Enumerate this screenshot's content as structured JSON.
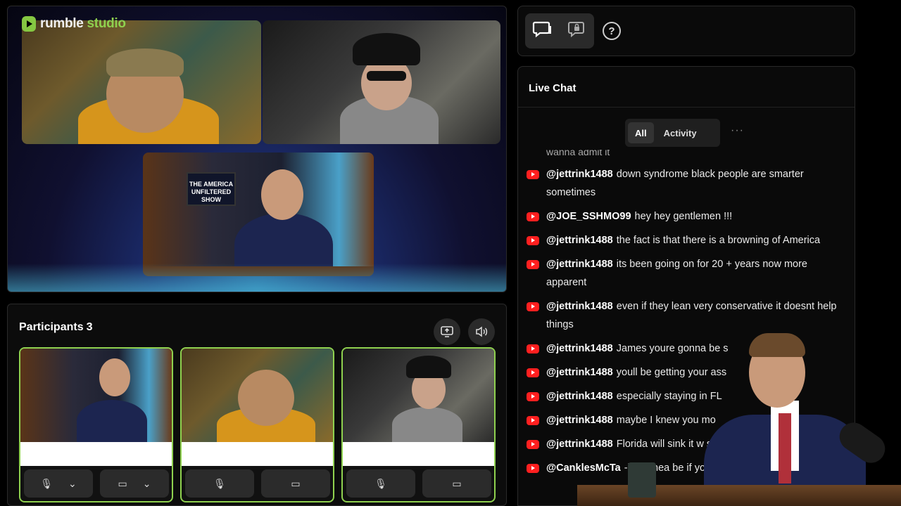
{
  "brand": {
    "logo_prefix": "rumble",
    "logo_suffix": "studio"
  },
  "stage": {
    "tv_text": "THE AMERICA UNFILTERED SHOW"
  },
  "participants": {
    "title": "Participants",
    "count": "3",
    "share_icon": "screen-share-icon",
    "audio_icon": "speaker-icon"
  },
  "toolbar": {
    "chat_icon": "chat-bubbles-icon",
    "private_icon": "locked-chat-icon",
    "help_label": "?"
  },
  "chat": {
    "title": "Live Chat",
    "tabs": [
      {
        "label": "All"
      },
      {
        "label": "Activity"
      }
    ],
    "more": "···",
    "cut_text": "wanna admit it",
    "messages": [
      {
        "user": "@jettrink1488",
        "text": "down syndrome black people are smarter sometimes"
      },
      {
        "user": "@JOE_SSHMO99",
        "text": "hey hey gentlemen !!!"
      },
      {
        "user": "@jettrink1488",
        "text": "the fact is that there is a browning of America"
      },
      {
        "user": "@jettrink1488",
        "text": "its been going on for 20 + years now more apparent"
      },
      {
        "user": "@jettrink1488",
        "text": "even if they lean very conservative it doesnt help things"
      },
      {
        "user": "@jettrink1488",
        "text": "James youre gonna be s"
      },
      {
        "user": "@jettrink1488",
        "text": "youll be getting your ass"
      },
      {
        "user": "@jettrink1488",
        "text": "especially staying in FL"
      },
      {
        "user": "@jettrink1488",
        "text": "maybe I knew you mo"
      },
      {
        "user": "@jettrink1488",
        "text": "Florida will sink it w sunk"
      },
      {
        "user": "@CanklesMcTa",
        "text": "-b5s I hea be if youre crazy"
      }
    ]
  },
  "colors": {
    "accent": "#8fd14f",
    "yt_red": "#ff1f1f",
    "panel": "#0a0a0a"
  }
}
